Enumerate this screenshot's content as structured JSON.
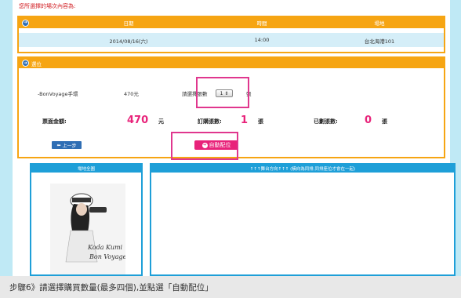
{
  "top_note": "您所選擇的場次內容為:",
  "session": {
    "headers": [
      "日期",
      "時間",
      "場地"
    ],
    "values": [
      "2014/08/16(六)",
      "14:00",
      "台北海港101"
    ]
  },
  "seat": {
    "title": "選位",
    "ticket_name": "-BonVoyage手環",
    "price": "470元",
    "qty_label": "請選擇張數",
    "qty_value": "1",
    "qty_unit": "張",
    "total_label": "票面金額:",
    "total_value": "470",
    "total_unit": "元",
    "ordered_label": "訂購張數:",
    "ordered_value": "1",
    "ordered_unit": "張",
    "assigned_label": "已劃張數:",
    "assigned_value": "0",
    "assigned_unit": "張"
  },
  "buttons": {
    "back": "上一步",
    "auto_assign": "自動配位"
  },
  "map_panel": {
    "title": "場地全圖"
  },
  "dir_panel": {
    "title": "↑↑↑舞台方向↑↑↑ (橫向為同排,同排座位才會在一起)"
  },
  "poster": {
    "line1": "Koda Kumi",
    "line2": "Bon Voyage"
  },
  "caption": "步驟6》請選擇購買數量(最多四個),並點選「自動配位」",
  "colors": {
    "orange": "#f6a513",
    "blue": "#1e9fd8",
    "pink": "#e8237a",
    "highlight": "#e0378e"
  }
}
